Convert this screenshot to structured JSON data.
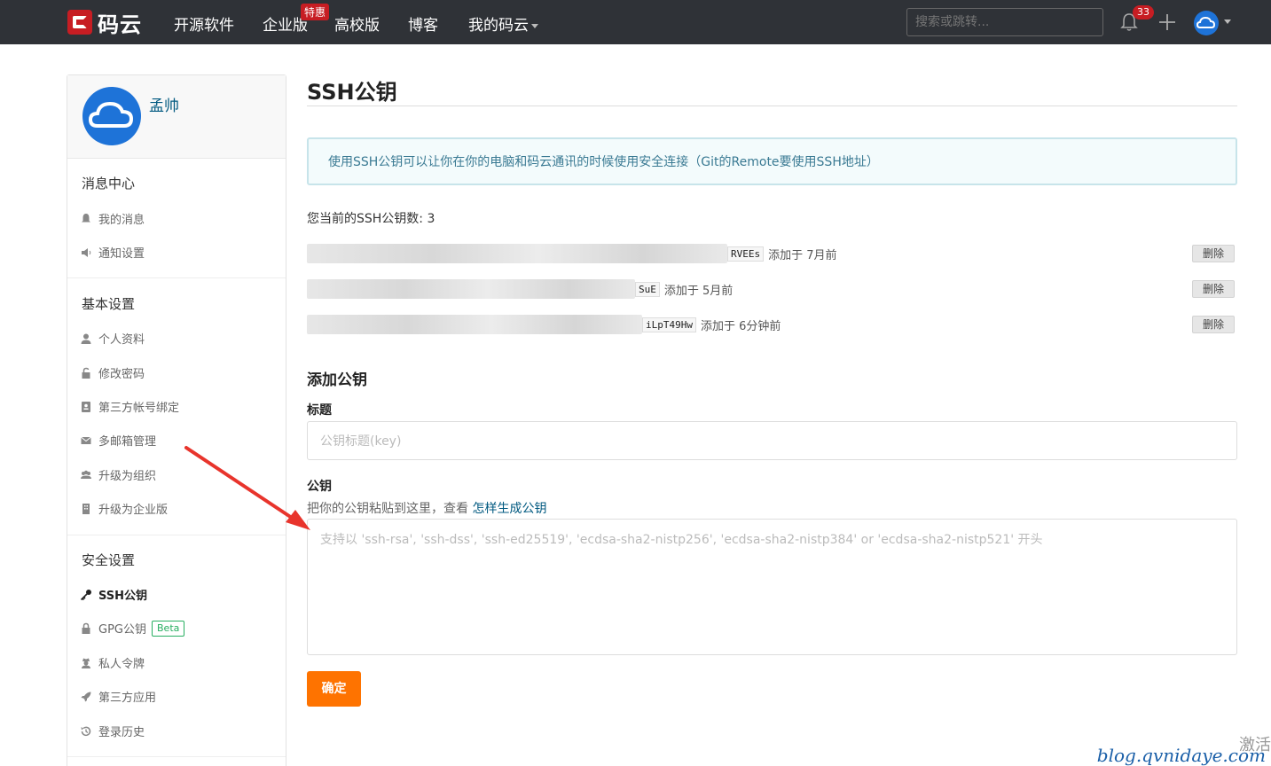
{
  "topnav": {
    "logo_text": "码云",
    "items": [
      "开源软件",
      "企业版",
      "高校版",
      "博客",
      "我的码云"
    ],
    "badge": "特惠",
    "search_placeholder": "搜索或跳转...",
    "notification_count": "33",
    "bg_color": "#2f3237",
    "brand_color": "#c71d23"
  },
  "sidebar": {
    "username": "孟帅",
    "section_messages": "消息中心",
    "messages_items": [
      "我的消息",
      "通知设置"
    ],
    "section_basic": "基本设置",
    "basic_items": [
      "个人资料",
      "修改密码",
      "第三方帐号绑定",
      "多邮箱管理",
      "升级为组织",
      "升级为企业版"
    ],
    "section_security": "安全设置",
    "security_items": [
      "SSH公钥",
      "GPG公钥",
      "私人令牌",
      "第三方应用",
      "登录历史"
    ],
    "beta_label": "Beta"
  },
  "main": {
    "title": "SSH公钥",
    "info": "使用SSH公钥可以让你在你的电脑和码云通讯的时候使用安全连接（Git的Remote要使用SSH地址）",
    "key_count_label": "您当前的SSH公钥数: 3",
    "keys": [
      {
        "tail": "RVEEs",
        "added": "添加于 7月前"
      },
      {
        "tail": "SuE",
        "added": "添加于 5月前"
      },
      {
        "tail": "iLpT49Hw",
        "added": "添加于 6分钟前"
      }
    ],
    "delete_label": "删除",
    "add_title": "添加公钥",
    "title_label": "标题",
    "title_placeholder": "公钥标题(key)",
    "key_label": "公钥",
    "hint_text": "把你的公钥粘贴到这里，查看 ",
    "hint_link": "怎样生成公钥",
    "key_placeholder": "支持以 'ssh-rsa', 'ssh-dss', 'ssh-ed25519', 'ecdsa-sha2-nistp256', 'ecdsa-sha2-nistp384' or 'ecdsa-sha2-nistp521' 开头",
    "confirm_label": "确定",
    "accent_color": "#fe7300"
  },
  "overlay": {
    "watermark": "blog.qvnidaye.com",
    "activate": "激活"
  }
}
